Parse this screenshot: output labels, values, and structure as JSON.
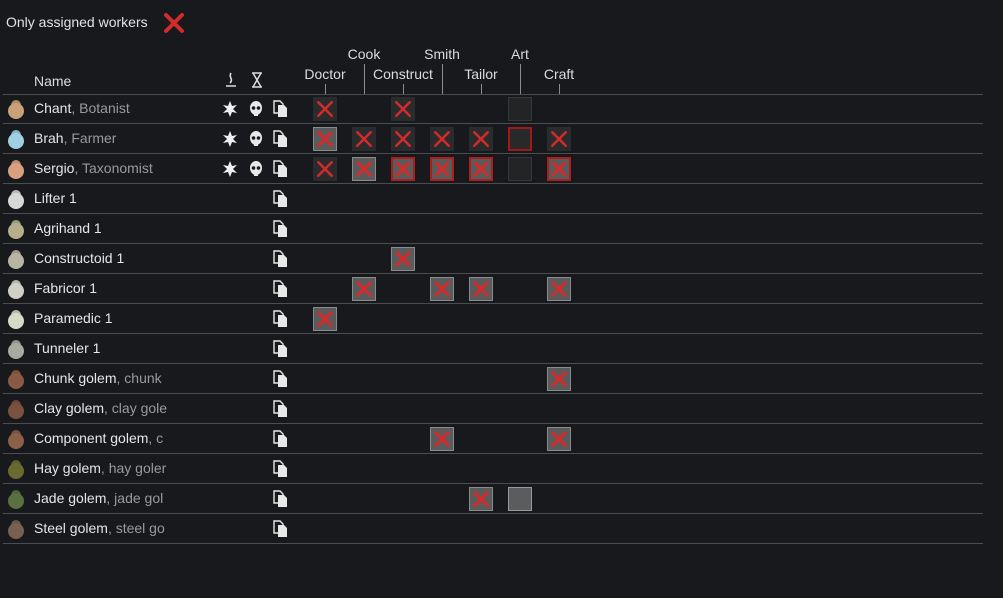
{
  "filter": {
    "label": "Only assigned workers"
  },
  "header": {
    "name": "Name",
    "columns": [
      "Doctor",
      "Cook",
      "Construct",
      "Smith",
      "Tailor",
      "Art",
      "Craft"
    ]
  },
  "workers": [
    {
      "name": "Chant",
      "sub": ", Botanist"
    },
    {
      "name": "Brah",
      "sub": ", Farmer"
    },
    {
      "name": "Sergio",
      "sub": ", Taxonomist"
    },
    {
      "name": "Lifter 1",
      "sub": ""
    },
    {
      "name": "Agrihand 1",
      "sub": ""
    },
    {
      "name": "Constructoid 1",
      "sub": ""
    },
    {
      "name": "Fabricor 1",
      "sub": ""
    },
    {
      "name": "Paramedic 1",
      "sub": ""
    },
    {
      "name": "Tunneler 1",
      "sub": ""
    },
    {
      "name": "Chunk golem",
      "sub": ", chunk"
    },
    {
      "name": "Clay golem",
      "sub": ", clay gole"
    },
    {
      "name": "Component golem",
      "sub": ", c"
    },
    {
      "name": "Hay golem",
      "sub": ", hay goler"
    },
    {
      "name": "Jade golem",
      "sub": ", jade gol"
    },
    {
      "name": "Steel golem",
      "sub": ", steel go"
    }
  ],
  "cells": [
    [
      "small",
      "",
      "small",
      "",
      "",
      "empty",
      ""
    ],
    [
      "big",
      "small",
      "small",
      "small",
      "small",
      "emptyred",
      "small"
    ],
    [
      "small",
      "big",
      "red",
      "red",
      "red",
      "empty",
      "red"
    ],
    [
      "",
      "",
      "",
      "",
      "",
      "",
      ""
    ],
    [
      "",
      "",
      "",
      "",
      "",
      "",
      ""
    ],
    [
      "",
      "",
      "big",
      "",
      "",
      "",
      ""
    ],
    [
      "",
      "big",
      "",
      "big",
      "big",
      "",
      "big"
    ],
    [
      "big",
      "",
      "",
      "",
      "",
      "",
      ""
    ],
    [
      "",
      "",
      "",
      "",
      "",
      "",
      ""
    ],
    [
      "",
      "",
      "",
      "",
      "",
      "",
      "big"
    ],
    [
      "",
      "",
      "",
      "",
      "",
      "",
      ""
    ],
    [
      "",
      "",
      "",
      "big",
      "",
      "",
      "big"
    ],
    [
      "",
      "",
      "",
      "",
      "",
      "",
      ""
    ],
    [
      "",
      "",
      "",
      "",
      "big",
      "grey",
      ""
    ],
    [
      "",
      "",
      "",
      "",
      "",
      "",
      ""
    ]
  ],
  "colors": {
    "accent_red": "#d42a2a",
    "background": "#17191c"
  }
}
